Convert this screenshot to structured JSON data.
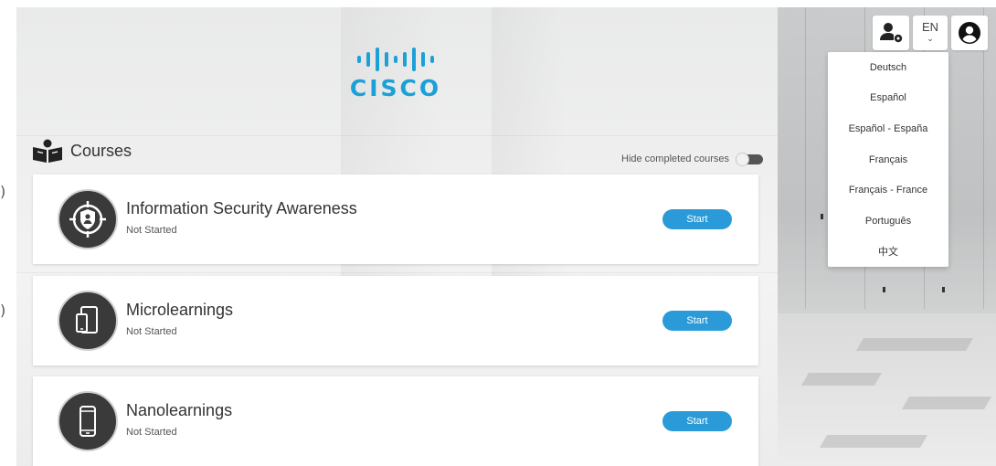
{
  "brand": {
    "name": "CISCO",
    "color": "#1ba0d7"
  },
  "edge": {
    "glyphs": [
      ")",
      ")"
    ]
  },
  "header": {
    "admin_icon": "user-settings-icon",
    "language_code": "EN",
    "language_chevron": "⌄",
    "account_icon": "account-circle-icon"
  },
  "language_menu": {
    "items": [
      "Deutsch",
      "Español",
      "Español - España",
      "Français",
      "Français - France",
      "Português",
      "中文"
    ]
  },
  "courses": {
    "title": "Courses",
    "hide_completed_label": "Hide completed courses",
    "hide_completed_on": false,
    "items": [
      {
        "title": "Information Security Awareness",
        "status": "Not Started",
        "button": "Start",
        "icon": "shield-user-target-icon"
      },
      {
        "title": "Microlearnings",
        "status": "Not Started",
        "button": "Start",
        "icon": "tablet-phone-icon"
      },
      {
        "title": "Nanolearnings",
        "status": "Not Started",
        "button": "Start",
        "icon": "smartphone-icon"
      }
    ]
  },
  "colors": {
    "accent": "#2a9bd8",
    "badge": "#3a3a3a"
  }
}
